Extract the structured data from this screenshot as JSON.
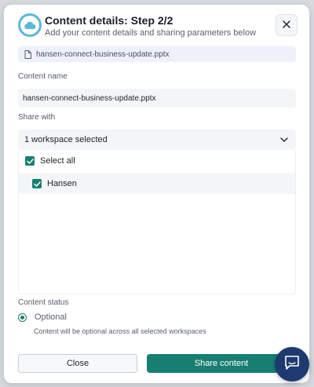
{
  "dialog": {
    "title": "Content details: Step 2/2",
    "subtitle": "Add your content details and sharing parameters below",
    "file": {
      "name": "hansen-connect-business-update.pptx",
      "icon": "document-icon"
    },
    "content_name": {
      "label": "Content name",
      "value": "hansen-connect-business-update.pptx"
    },
    "share_with": {
      "label": "Share with",
      "selected": "1 workspace selected",
      "select_all_label": "Select all",
      "select_all_checked": true,
      "options": [
        {
          "label": "Hansen",
          "checked": true
        }
      ]
    },
    "content_status": {
      "label": "Content status",
      "option_label": "Optional",
      "selected": true,
      "hint": "Content will be optional across all selected workspaces"
    },
    "buttons": {
      "close": "Close",
      "share": "Share content"
    }
  },
  "colors": {
    "accent": "#177f72",
    "header_icon": "#5bb8d6",
    "chat_bubble": "#1f3a6e"
  },
  "icons": {
    "header": "cloud-icon",
    "close": "close-icon",
    "select": "chevron-down-icon",
    "chat": "chat-icon"
  }
}
